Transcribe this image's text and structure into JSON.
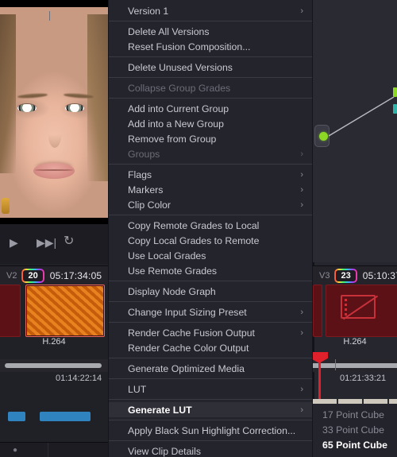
{
  "viewer": {
    "name": "source-viewer",
    "transport": {
      "play": "▶",
      "next": "▶▶|",
      "loop": "↻"
    }
  },
  "left_timeline": {
    "track": "V2",
    "badge": "20",
    "timecode": "05:17:34:05",
    "codec": "H.264",
    "ruler_timecode": "01:14:22:14"
  },
  "right_timeline": {
    "track": "V3",
    "badge": "23",
    "timecode": "05:10:37",
    "codec": "H.264",
    "ruler_timecode": "01:21:33:21"
  },
  "context_menu": {
    "items": [
      {
        "label": "Version 1",
        "submenu": true,
        "disabled": false,
        "highlighted": false,
        "sep_after": true
      },
      {
        "label": "Delete All Versions",
        "submenu": false,
        "disabled": false,
        "highlighted": false,
        "sep_after": false
      },
      {
        "label": "Reset Fusion Composition...",
        "submenu": false,
        "disabled": false,
        "highlighted": false,
        "sep_after": true
      },
      {
        "label": "Delete Unused Versions",
        "submenu": false,
        "disabled": false,
        "highlighted": false,
        "sep_after": true
      },
      {
        "label": "Collapse Group Grades",
        "submenu": false,
        "disabled": true,
        "highlighted": false,
        "sep_after": true
      },
      {
        "label": "Add into Current Group",
        "submenu": false,
        "disabled": false,
        "highlighted": false,
        "sep_after": false
      },
      {
        "label": "Add into a New Group",
        "submenu": false,
        "disabled": false,
        "highlighted": false,
        "sep_after": false
      },
      {
        "label": "Remove from Group",
        "submenu": false,
        "disabled": false,
        "highlighted": false,
        "sep_after": false
      },
      {
        "label": "Groups",
        "submenu": true,
        "disabled": true,
        "highlighted": false,
        "sep_after": true
      },
      {
        "label": "Flags",
        "submenu": true,
        "disabled": false,
        "highlighted": false,
        "sep_after": false
      },
      {
        "label": "Markers",
        "submenu": true,
        "disabled": false,
        "highlighted": false,
        "sep_after": false
      },
      {
        "label": "Clip Color",
        "submenu": true,
        "disabled": false,
        "highlighted": false,
        "sep_after": true
      },
      {
        "label": "Copy Remote Grades to Local",
        "submenu": false,
        "disabled": false,
        "highlighted": false,
        "sep_after": false
      },
      {
        "label": "Copy Local Grades to Remote",
        "submenu": false,
        "disabled": false,
        "highlighted": false,
        "sep_after": false
      },
      {
        "label": "Use Local Grades",
        "submenu": false,
        "disabled": false,
        "highlighted": false,
        "sep_after": false
      },
      {
        "label": "Use Remote Grades",
        "submenu": false,
        "disabled": false,
        "highlighted": false,
        "sep_after": true
      },
      {
        "label": "Display Node Graph",
        "submenu": false,
        "disabled": false,
        "highlighted": false,
        "sep_after": true
      },
      {
        "label": "Change Input Sizing Preset",
        "submenu": true,
        "disabled": false,
        "highlighted": false,
        "sep_after": true
      },
      {
        "label": "Render Cache Fusion Output",
        "submenu": true,
        "disabled": false,
        "highlighted": false,
        "sep_after": false
      },
      {
        "label": "Render Cache Color Output",
        "submenu": false,
        "disabled": false,
        "highlighted": false,
        "sep_after": true
      },
      {
        "label": "Generate Optimized Media",
        "submenu": false,
        "disabled": false,
        "highlighted": false,
        "sep_after": true
      },
      {
        "label": "LUT",
        "submenu": true,
        "disabled": false,
        "highlighted": false,
        "sep_after": true
      },
      {
        "label": "Generate LUT",
        "submenu": true,
        "disabled": false,
        "highlighted": true,
        "sep_after": true
      },
      {
        "label": "Apply Black Sun Highlight Correction...",
        "submenu": false,
        "disabled": false,
        "highlighted": false,
        "sep_after": true
      },
      {
        "label": "View Clip Details",
        "submenu": false,
        "disabled": false,
        "highlighted": false,
        "sep_after": false
      }
    ]
  },
  "submenu": {
    "title": "Generate LUT",
    "items": [
      {
        "label": "17 Point Cube",
        "highlighted": false
      },
      {
        "label": "33 Point Cube",
        "highlighted": false
      },
      {
        "label": "65 Point Cube",
        "highlighted": true
      }
    ]
  },
  "colors": {
    "menu_bg": "#24242c",
    "menu_highlight": "#2f2f38",
    "separator": "#3a3a45",
    "text": "#c9c9d2",
    "text_disabled": "#6d6d78",
    "playhead": "#e0202a",
    "node_green": "#8cd824",
    "audio_blue": "#2f84bf",
    "missing_media_red": "#c8313a"
  }
}
